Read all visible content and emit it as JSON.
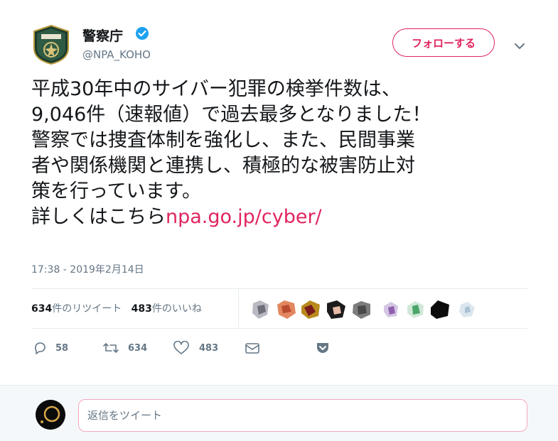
{
  "author": {
    "display_name": "警察庁",
    "handle": "@NPA_KOHO",
    "verified_icon": "verified-badge-icon"
  },
  "follow_button_label": "フォローする",
  "tweet": {
    "lines": [
      "平成30年中のサイバー犯罪の検挙件数は、",
      "9,046件（速報値）で過去最多となりました！",
      "警察では捜査体制を強化し、また、民間事業",
      "者や関係機関と連携し、積極的な被害防止対",
      "策を行っています。"
    ],
    "last_line_prefix": "詳しくはこちら",
    "link_text": "npa.go.jp/cyber/",
    "timestamp": "17:38 - 2019年2月14日"
  },
  "stats": {
    "retweet_count": "634",
    "retweet_label": "件のリツイート",
    "like_count": "483",
    "like_label": "件のいいね"
  },
  "actions": {
    "reply_count": "58",
    "retweet_count": "634",
    "like_count": "483"
  },
  "reply_box": {
    "placeholder": "返信をツイート"
  },
  "colors": {
    "accent": "#e0245e",
    "verified": "#1da1f2",
    "secondary_text": "#657786"
  }
}
